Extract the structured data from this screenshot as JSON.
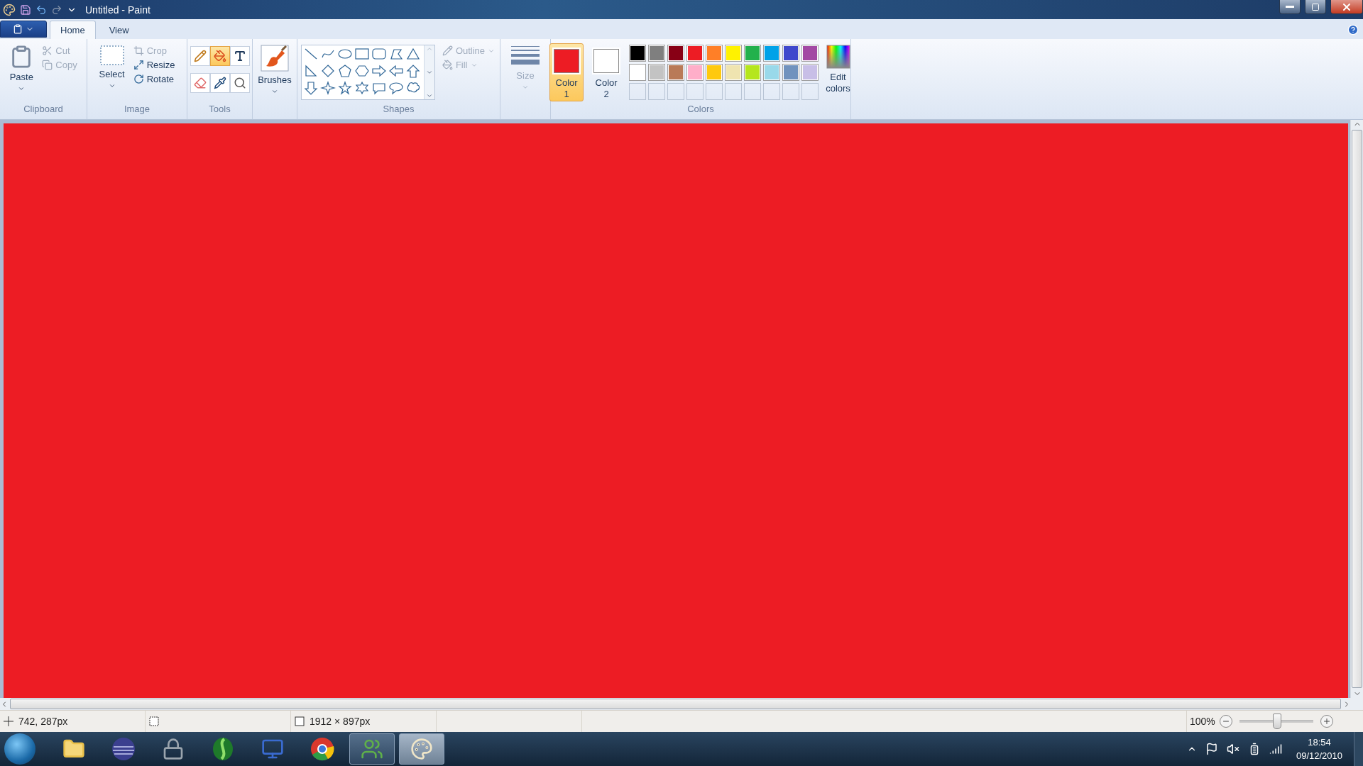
{
  "window": {
    "title": "Untitled - Paint"
  },
  "tabs": [
    {
      "label": "Home",
      "selected": true
    },
    {
      "label": "View",
      "selected": false
    }
  ],
  "clipboard": {
    "label": "Clipboard",
    "paste": "Paste",
    "items": [
      {
        "kind": "cut",
        "label": "Cut",
        "disabled": true
      },
      {
        "kind": "copy",
        "label": "Copy",
        "disabled": true
      }
    ]
  },
  "image": {
    "label": "Image",
    "select": "Select",
    "items": [
      {
        "kind": "crop",
        "label": "Crop",
        "disabled": true
      },
      {
        "kind": "resize",
        "label": "Resize",
        "disabled": false
      },
      {
        "kind": "rotate",
        "label": "Rotate",
        "disabled": false
      }
    ]
  },
  "tools": {
    "label": "Tools",
    "items": [
      {
        "kind": "pencil",
        "selected": false
      },
      {
        "kind": "fill",
        "selected": true
      },
      {
        "kind": "text",
        "selected": false
      },
      {
        "kind": "eraser",
        "selected": false
      },
      {
        "kind": "picker",
        "selected": false
      },
      {
        "kind": "magnifier",
        "selected": false
      }
    ]
  },
  "brushes": {
    "label": "Brushes"
  },
  "shapes": {
    "label": "Shapes",
    "outline": {
      "label": "Outline",
      "disabled": true
    },
    "fill": {
      "label": "Fill",
      "disabled": true
    }
  },
  "size": {
    "label": "Size",
    "disabled": true
  },
  "colors": {
    "label": "Colors",
    "current": [
      {
        "label": "Color",
        "number": "1",
        "color": "#ed1c24",
        "selected": true
      },
      {
        "label": "Color",
        "number": "2",
        "color": "#ffffff",
        "selected": false
      }
    ],
    "palette": [
      {
        "color": "#000000"
      },
      {
        "color": "#7f7f7f"
      },
      {
        "color": "#880015"
      },
      {
        "color": "#ed1c24"
      },
      {
        "color": "#ff7f27"
      },
      {
        "color": "#fff200"
      },
      {
        "color": "#22b14c"
      },
      {
        "color": "#00a2e8"
      },
      {
        "color": "#3f48cc"
      },
      {
        "color": "#a349a4"
      },
      {
        "color": "#ffffff"
      },
      {
        "color": "#c3c3c3"
      },
      {
        "color": "#b97a57"
      },
      {
        "color": "#ffaec9"
      },
      {
        "color": "#ffc90e"
      },
      {
        "color": "#efe4b0"
      },
      {
        "color": "#b5e61d"
      },
      {
        "color": "#99d9ea"
      },
      {
        "color": "#7092be"
      },
      {
        "color": "#c8bfe7"
      }
    ],
    "edit": "Edit colors"
  },
  "canvas": {
    "color": "#ed1c24"
  },
  "status": {
    "cursor": "742, 287px",
    "size": "1912 × 897px",
    "zoom": "100%",
    "level": 0.5
  },
  "taskbar": {
    "apps": [
      {
        "kind": "folder",
        "open": false,
        "selected": false
      },
      {
        "kind": "sphere",
        "open": false,
        "selected": false
      },
      {
        "kind": "lock",
        "open": false,
        "selected": false
      },
      {
        "kind": "leaf",
        "open": false,
        "selected": false
      },
      {
        "kind": "network",
        "open": false,
        "selected": false
      },
      {
        "kind": "chrome",
        "open": false,
        "selected": false
      },
      {
        "kind": "people",
        "open": true,
        "selected": false
      },
      {
        "kind": "palette",
        "open": true,
        "selected": true
      }
    ],
    "time": "18:54",
    "date": "09/12/2010"
  }
}
